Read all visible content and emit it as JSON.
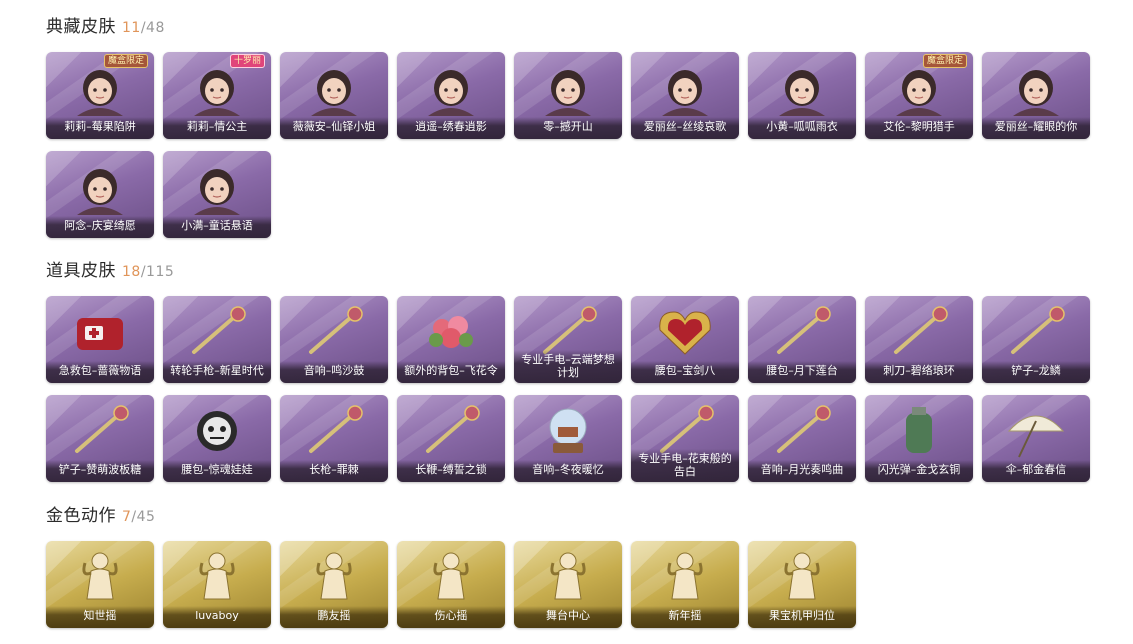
{
  "sections": [
    {
      "title": "典藏皮肤",
      "owned": "11",
      "total": "/48",
      "theme": "purple",
      "items": [
        {
          "label": "莉莉–莓果陷阱",
          "icon": "character-portrait-icon",
          "badge": "魔盒限定"
        },
        {
          "label": "莉莉–情公主",
          "icon": "character-portrait-icon",
          "badge": "十罗丽"
        },
        {
          "label": "薇薇安–仙铎小姐",
          "icon": "character-portrait-icon"
        },
        {
          "label": "逍遥–绣春逍影",
          "icon": "character-portrait-icon"
        },
        {
          "label": "零–撼开山",
          "icon": "character-portrait-icon"
        },
        {
          "label": "爱丽丝–丝绫哀歌",
          "icon": "character-portrait-icon"
        },
        {
          "label": "小黄–呱呱雨衣",
          "icon": "character-portrait-icon"
        },
        {
          "label": "艾伦–黎明猎手",
          "icon": "character-portrait-icon",
          "badge": "魔盒限定"
        },
        {
          "label": "爱丽丝–耀眼的你",
          "icon": "character-portrait-icon"
        },
        {
          "label": "阿念–庆宴绮愿",
          "icon": "character-portrait-icon"
        },
        {
          "label": "小满–童话悬语",
          "icon": "character-portrait-icon"
        }
      ]
    },
    {
      "title": "道具皮肤",
      "owned": "18",
      "total": "/115",
      "theme": "purple",
      "items": [
        {
          "label": "急救包–蔷薇物语",
          "icon": "medkit-icon"
        },
        {
          "label": "转轮手枪–新星时代",
          "icon": "revolver-icon"
        },
        {
          "label": "音响–鸣沙鼓",
          "icon": "drum-icon"
        },
        {
          "label": "额外的背包–飞花令",
          "icon": "flower-bag-icon"
        },
        {
          "label": "专业手电–云端梦想计划",
          "icon": "flashlight-icon"
        },
        {
          "label": "腰包–宝剑八",
          "icon": "heart-shield-icon"
        },
        {
          "label": "腰包–月下莲台",
          "icon": "scepter-icon"
        },
        {
          "label": "刺刀–碧络琅环",
          "icon": "blade-icon"
        },
        {
          "label": "铲子–龙鳞",
          "icon": "shovel-icon"
        },
        {
          "label": "铲子–赞萌波板糖",
          "icon": "lollipop-shovel-icon"
        },
        {
          "label": "腰包–惊魂娃娃",
          "icon": "doll-icon"
        },
        {
          "label": "长枪–罪棘",
          "icon": "spear-icon"
        },
        {
          "label": "长鞭–缚誓之锁",
          "icon": "whip-icon"
        },
        {
          "label": "音响–冬夜暖忆",
          "icon": "snow-globe-icon"
        },
        {
          "label": "专业手电–花束般的告白",
          "icon": "rose-flashlight-icon"
        },
        {
          "label": "音响–月光奏鸣曲",
          "icon": "music-box-icon"
        },
        {
          "label": "闪光弹–金戈玄铜",
          "icon": "grenade-icon"
        },
        {
          "label": "伞–郁金春信",
          "icon": "umbrella-icon"
        }
      ]
    },
    {
      "title": "金色动作",
      "owned": "7",
      "total": "/45",
      "theme": "gold",
      "items": [
        {
          "label": "知世摇",
          "icon": "dance-pose-icon"
        },
        {
          "label": "luvaboy",
          "icon": "dance-pose-icon"
        },
        {
          "label": "鹏友摇",
          "icon": "dance-pose-icon"
        },
        {
          "label": "伤心摇",
          "icon": "dance-pose-icon"
        },
        {
          "label": "舞台中心",
          "icon": "dance-pose-icon"
        },
        {
          "label": "新年摇",
          "icon": "dance-pose-icon"
        },
        {
          "label": "果宝机甲归位",
          "icon": "dance-pose-icon"
        }
      ]
    }
  ],
  "colors": {
    "owned_count": "#e0955a",
    "total_count": "#999999",
    "purple_card": "#8a6aa8",
    "gold_card": "#c7ad4e"
  }
}
